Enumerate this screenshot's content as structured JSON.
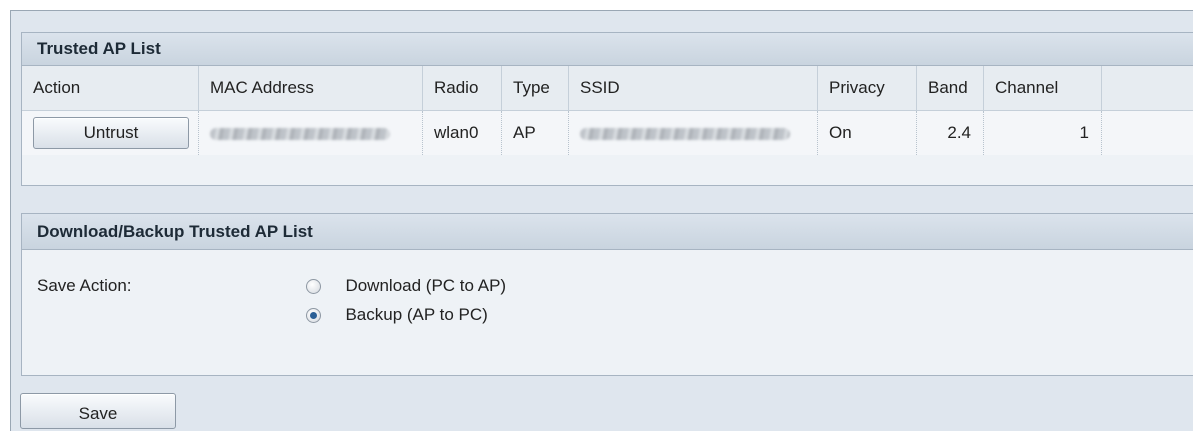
{
  "trusted_ap_list": {
    "title": "Trusted AP List",
    "columns": [
      "Action",
      "MAC Address",
      "Radio",
      "Type",
      "SSID",
      "Privacy",
      "Band",
      "Channel"
    ],
    "rows": [
      {
        "action_label": "Untrust",
        "mac_address": "",
        "radio": "wlan0",
        "type": "AP",
        "ssid": "",
        "privacy": "On",
        "band": "2.4",
        "channel": "1"
      }
    ]
  },
  "download_backup": {
    "title": "Download/Backup Trusted AP List",
    "save_action_label": "Save Action:",
    "options": [
      {
        "label": "Download (PC to AP)",
        "selected": false
      },
      {
        "label": "Backup (AP to PC)",
        "selected": true
      }
    ]
  },
  "save_button_label": "Save"
}
